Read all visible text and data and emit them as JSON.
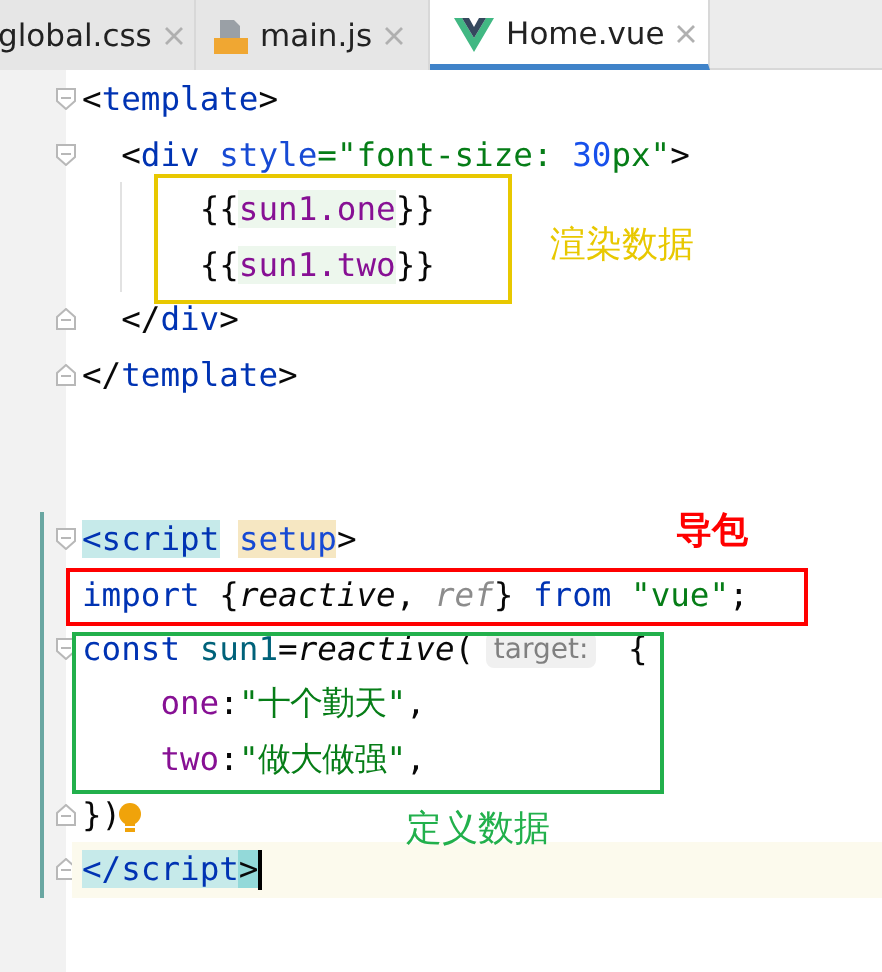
{
  "tabs": [
    {
      "label": "global.css",
      "kind": "css",
      "selected": false
    },
    {
      "label": "main.js",
      "kind": "js",
      "selected": false
    },
    {
      "label": "Home.vue",
      "kind": "vue",
      "selected": true
    }
  ],
  "lines": [
    {
      "fold_start": true,
      "fold_end": false,
      "changed": false,
      "current": false,
      "guide": false,
      "tokens": [
        {
          "text": "<",
          "kind": "punct"
        },
        {
          "text": "template",
          "kind": "tag"
        },
        {
          "text": ">",
          "kind": "punct"
        }
      ]
    },
    {
      "fold_start": true,
      "fold_end": false,
      "changed": false,
      "current": false,
      "guide": false,
      "tokens": [
        {
          "text": "  <",
          "kind": "punct"
        },
        {
          "text": "div ",
          "kind": "tag"
        },
        {
          "text": "style",
          "kind": "attr"
        },
        {
          "text": "=\"font-size: ",
          "kind": "str"
        },
        {
          "text": "30",
          "kind": "num"
        },
        {
          "text": "px\"",
          "kind": "str"
        },
        {
          "text": ">",
          "kind": "punct"
        }
      ]
    },
    {
      "fold_start": false,
      "fold_end": false,
      "changed": false,
      "current": false,
      "guide": true,
      "tokens": [
        {
          "text": "      {{",
          "kind": "punct"
        },
        {
          "text": "sun1.one",
          "kind": "prop-inject"
        },
        {
          "text": "}}",
          "kind": "punct"
        }
      ]
    },
    {
      "fold_start": false,
      "fold_end": false,
      "changed": false,
      "current": false,
      "guide": true,
      "tokens": [
        {
          "text": "      {{",
          "kind": "punct"
        },
        {
          "text": "sun1.two",
          "kind": "prop-inject"
        },
        {
          "text": "}}",
          "kind": "punct"
        }
      ]
    },
    {
      "fold_start": false,
      "fold_end": true,
      "changed": false,
      "current": false,
      "guide": false,
      "tokens": [
        {
          "text": "  </",
          "kind": "punct"
        },
        {
          "text": "div",
          "kind": "tag"
        },
        {
          "text": ">",
          "kind": "punct"
        }
      ]
    },
    {
      "fold_start": false,
      "fold_end": true,
      "changed": false,
      "current": false,
      "guide": false,
      "tokens": [
        {
          "text": "</",
          "kind": "punct"
        },
        {
          "text": "template",
          "kind": "tag"
        },
        {
          "text": ">",
          "kind": "punct"
        }
      ]
    },
    {
      "fold_start": false,
      "fold_end": false,
      "changed": false,
      "current": false,
      "guide": false
    },
    {
      "fold_start": false,
      "fold_end": false,
      "changed": false,
      "current": false,
      "guide": false
    },
    {
      "fold_start": true,
      "fold_end": false,
      "changed": true,
      "current": false,
      "guide": false,
      "tokens": [
        {
          "text": "<script",
          "kind": "tag-match"
        },
        {
          "text": " setup",
          "kind": "attr-usage"
        },
        {
          "text": ">",
          "kind": "punct"
        }
      ]
    },
    {
      "fold_start": false,
      "fold_end": false,
      "changed": true,
      "current": false,
      "guide": false,
      "tokens": [
        {
          "text": "import ",
          "kind": "kw"
        },
        {
          "text": "{",
          "kind": "punct"
        },
        {
          "text": "reactive",
          "kind": "fn"
        },
        {
          "text": ", ",
          "kind": "punct"
        },
        {
          "text": "ref",
          "kind": "unused"
        },
        {
          "text": "} ",
          "kind": "punct"
        },
        {
          "text": "from ",
          "kind": "kw"
        },
        {
          "text": "\"vue\"",
          "kind": "str"
        },
        {
          "text": ";",
          "kind": "punct"
        }
      ]
    },
    {
      "fold_start": true,
      "fold_end": false,
      "changed": true,
      "current": false,
      "guide": false,
      "tokens": [
        {
          "text": "const ",
          "kind": "kw"
        },
        {
          "text": "sun1",
          "kind": "var"
        },
        {
          "text": "=",
          "kind": "punct"
        },
        {
          "text": "reactive",
          "kind": "fn"
        },
        {
          "text": "( ",
          "kind": "punct"
        },
        {
          "text": "target:",
          "kind": "hint"
        },
        {
          "text": " {",
          "kind": "punct"
        }
      ]
    },
    {
      "fold_start": false,
      "fold_end": false,
      "changed": true,
      "current": false,
      "guide": false,
      "tokens": [
        {
          "text": "    one",
          "kind": "prop"
        },
        {
          "text": ":",
          "kind": "punct"
        },
        {
          "text": "\"十个勤天\"",
          "kind": "str"
        },
        {
          "text": ",",
          "kind": "punct"
        }
      ]
    },
    {
      "fold_start": false,
      "fold_end": false,
      "changed": true,
      "current": false,
      "guide": false,
      "tokens": [
        {
          "text": "    two",
          "kind": "prop"
        },
        {
          "text": ":",
          "kind": "punct"
        },
        {
          "text": "\"做大做强\"",
          "kind": "str"
        },
        {
          "text": ",",
          "kind": "punct"
        }
      ]
    },
    {
      "fold_start": false,
      "fold_end": true,
      "changed": true,
      "current": false,
      "guide": false,
      "bulb": true,
      "tokens": [
        {
          "text": "})",
          "kind": "punct"
        }
      ]
    },
    {
      "fold_start": false,
      "fold_end": true,
      "changed": true,
      "current": true,
      "guide": false,
      "caret": true,
      "tokens": [
        {
          "text": "</script",
          "kind": "tag-match"
        },
        {
          "text": ">",
          "kind": "punct-matchend"
        }
      ]
    }
  ],
  "annotations": [
    {
      "label": "渲染数据",
      "color": "#e8c800"
    },
    {
      "label": "导包",
      "color": "#ff0000"
    },
    {
      "label": "定义数据",
      "color": "#22b04c"
    }
  ]
}
